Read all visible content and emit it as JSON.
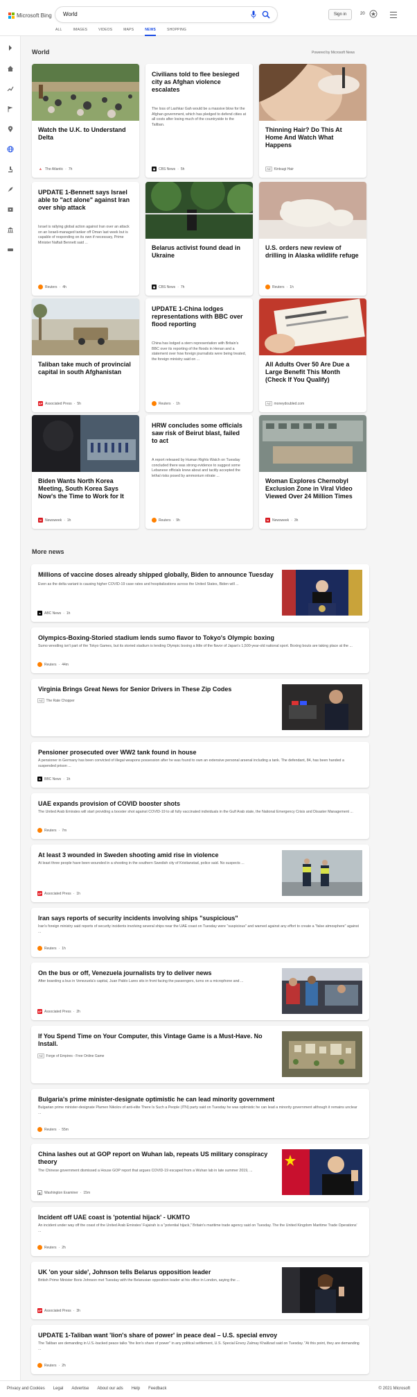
{
  "header": {
    "logo_text": "Microsoft Bing",
    "search_query": "World",
    "signin_label": "Sign in",
    "points": "20",
    "logo_colors": [
      "#f25022",
      "#7fba00",
      "#00a4ef",
      "#ffb900"
    ],
    "accent_color": "#174ae4"
  },
  "tabs": [
    {
      "label": "ALL"
    },
    {
      "label": "IMAGES"
    },
    {
      "label": "VIDEOS"
    },
    {
      "label": "MAPS"
    },
    {
      "label": "NEWS",
      "active": true
    },
    {
      "label": "SHOPPING"
    }
  ],
  "rail_icons": [
    "collapse-icon",
    "home-icon",
    "trending-icon",
    "flag-icon",
    "location-icon",
    "globe-icon",
    "microscope-icon",
    "rocket-icon",
    "movie-icon",
    "bank-icon",
    "sports-icon"
  ],
  "world": {
    "title": "World",
    "powered_by": "Powered by Microsoft News",
    "cards": [
      {
        "title": "Watch the U.K. to Understand Delta",
        "source": "The Atlantic",
        "time": "7h",
        "source_icon": "atlantic-icon",
        "has_image": true
      },
      {
        "title": "Civilians told to flee besieged city as Afghan violence escalates",
        "snippet": "The loss of Lashkar Gah would be a massive blow for the Afghan government, which has pledged to defend cities at all costs after losing much of the countryside to the Taliban.",
        "source": "CBS News",
        "time": "5h",
        "source_icon": "cbs-icon",
        "has_image": false
      },
      {
        "title": "Thinning Hair? Do This At Home And Watch What Happens",
        "source": "Kintsugi Hair",
        "ad": "Ad",
        "has_image": true
      },
      {
        "title": "UPDATE 1-Bennett says Israel able to \"act alone\" against Iran over ship attack",
        "snippet": "Israel is rallying global action against Iran over an attack on an Israeli-managed tanker off Oman last week but is capable of responding on its own if necessary, Prime Minister Naftali Bennett said ...",
        "source": "Reuters",
        "time": "4h",
        "source_icon": "reuters-icon",
        "has_image": false
      },
      {
        "title": "Belarus activist found dead in Ukraine",
        "source": "CBS News",
        "time": "7h",
        "source_icon": "cbs-icon",
        "has_image": true
      },
      {
        "title": "U.S. orders new review of drilling in Alaska wildlife refuge",
        "source": "Reuters",
        "time": "1h",
        "source_icon": "reuters-icon",
        "has_image": true
      },
      {
        "title": "Taliban take much of provincial capital in south Afghanistan",
        "source": "Associated Press",
        "time": "5h",
        "source_icon": "ap-icon",
        "has_image": true
      },
      {
        "title": "UPDATE 1-China lodges representations with BBC over flood reporting",
        "snippet": "China has lodged a stern representation with Britain's BBC over its reporting of the floods in Henan and a statement over how foreign journalists were being treated, the foreign ministry said on ...",
        "source": "Reuters",
        "time": "1h",
        "source_icon": "reuters-icon",
        "has_image": false
      },
      {
        "title": "All Adults Over 50 Are Due a Large Benefit This Month (Check If You Qualify)",
        "source": "moneydoubled.com",
        "ad": "Ad",
        "has_image": true
      },
      {
        "title": "Biden Wants North Korea Meeting, South Korea Says Now's the Time to Work for It",
        "source": "Newsweek",
        "time": "1h",
        "source_icon": "newsweek-icon",
        "has_image": true
      },
      {
        "title": "HRW concludes some officials saw risk of Beirut blast, failed to act",
        "snippet": "A report released by Human Rights Watch on Tuesday concluded there was strong evidence to suggest some Lebanese officials knew about and tacitly accepted the lethal risks posed by ammonium nitrate ...",
        "source": "Reuters",
        "time": "9h",
        "source_icon": "reuters-icon",
        "has_image": false
      },
      {
        "title": "Woman Explores Chernobyl Exclusion Zone in Viral Video Viewed Over 24 Million Times",
        "source": "Newsweek",
        "time": "3h",
        "source_icon": "newsweek-icon",
        "has_image": true
      }
    ]
  },
  "more_news": {
    "title": "More news",
    "items": [
      {
        "title": "Millions of vaccine doses already shipped globally, Biden to announce Tuesday",
        "snippet": "Even as the delta variant is causing higher COVID-19 case rates and hospitalizations across the United States, Biden will ...",
        "source": "ABC News",
        "time": "1h",
        "source_icon": "abc-icon",
        "has_image": true
      },
      {
        "title": "Olympics-Boxing-Storied stadium lends sumo flavor to Tokyo's Olympic boxing",
        "snippet": "Sumo wrestling isn't part of the Tokyo Games, but its storied stadium is lending Olympic boxing a little of the flavor of Japan's 1,500-year-old national sport. Boxing bouts are taking place at the ...",
        "source": "Reuters",
        "time": "44m",
        "source_icon": "reuters-icon",
        "has_image": false
      },
      {
        "title": "Virginia Brings Great News for Senior Drivers in These Zip Codes",
        "source": "The Rate Chopper",
        "ad": "Ad",
        "has_image": true
      },
      {
        "title": "Pensioner prosecuted over WW2 tank found in house",
        "snippet": "A pensioner in Germany has been convicted of illegal weapons possession after he was found to own an extensive personal arsenal including a tank. The defendant, 84, has been handed a suspended prison ...",
        "source": "BBC News",
        "time": "1h",
        "source_icon": "bbc-icon",
        "has_image": false
      },
      {
        "title": "UAE expands provision of COVID booster shots",
        "snippet": "The United Arab Emirates will start providing a booster shot against COVID-19 to all fully vaccinated individuals in the Gulf Arab state, the National Emergency Crisis and Disaster Management ...",
        "source": "Reuters",
        "time": "7m",
        "source_icon": "reuters-icon",
        "has_image": false
      },
      {
        "title": "At least 3 wounded in Sweden shooting amid rise in violence",
        "snippet": "At least three people have been wounded in a shooting in the southern Swedish city of Kristianstad, police said. No suspects ...",
        "source": "Associated Press",
        "time": "1h",
        "source_icon": "ap-icon",
        "has_image": true
      },
      {
        "title": "Iran says reports of security incidents involving ships \"suspicious\"",
        "snippet": "Iran's foreign ministry said reports of security incidents involving several ships near the UAE coast on Tuesday were \"suspicious\" and warned against any effort to create a \"false atmosphere\" against ...",
        "source": "Reuters",
        "time": "1h",
        "source_icon": "reuters-icon",
        "has_image": false
      },
      {
        "title": "On the bus or off, Venezuela journalists try to deliver news",
        "snippet": "After boarding a bus in Venezuela's capital, Juan Pablo Lares sits in front facing the passengers, turns on a microphone and ...",
        "source": "Associated Press",
        "time": "2h",
        "source_icon": "ap-icon",
        "has_image": true
      },
      {
        "title": "If You Spend Time on Your Computer, this Vintage Game is a Must-Have. No Install.",
        "source": "Forge of Empires - Free Online Game",
        "ad": "Ad",
        "has_image": true
      },
      {
        "title": "Bulgaria's prime minister-designate optimistic he can lead minority government",
        "snippet": "Bulgarian prime minister-designate Plamen Nikolov of anti-elite There Is Such a People (ITN) party said on Tuesday he was optimistic he can lead a minority government although it remains unclear ...",
        "source": "Reuters",
        "time": "55m",
        "source_icon": "reuters-icon",
        "has_image": false
      },
      {
        "title": "China lashes out at GOP report on Wuhan lab, repeats US military conspiracy theory",
        "snippet": "The Chinese government dismissed a House GOP report that argues COVID-19 escaped from a Wuhan lab in late summer 2019, ...",
        "source": "Washington Examiner",
        "time": "15m",
        "source_icon": "examiner-icon",
        "has_image": true
      },
      {
        "title": "Incident off UAE coast is 'potential hijack' - UKMTO",
        "snippet": "An incident under way off the coast of the United Arab Emirates' Fujairah is a \"potential hijack,\" Britain's maritime trade agency said on Tuesday. The the United Kingdom Maritime Trade Operations' ...",
        "source": "Reuters",
        "time": "2h",
        "source_icon": "reuters-icon",
        "has_image": false
      },
      {
        "title": "UK 'on your side', Johnson tells Belarus opposition leader",
        "snippet": "British Prime Minister Boris Johnson met Tuesday with the Belarusian opposition leader at his office in London, saying the ...",
        "source": "Associated Press",
        "time": "3h",
        "source_icon": "ap-icon",
        "has_image": true
      },
      {
        "title": "UPDATE 1-Taliban want 'lion's share of power' in peace deal – U.S. special envoy",
        "snippet": "The Taliban are demanding in U.S.-backed peace talks \"the lion's share of power\" in any political settlement, U.S. Special Envoy Zalmay Khalilzad said on Tuesday. \"At this point, they are demanding ...",
        "source": "Reuters",
        "time": "2h",
        "source_icon": "reuters-icon",
        "has_image": false
      }
    ]
  },
  "footer": {
    "links": [
      "Privacy and Cookies",
      "Legal",
      "Advertise",
      "About our ads",
      "Help",
      "Feedback"
    ],
    "copyright": "© 2021 Microsoft"
  }
}
